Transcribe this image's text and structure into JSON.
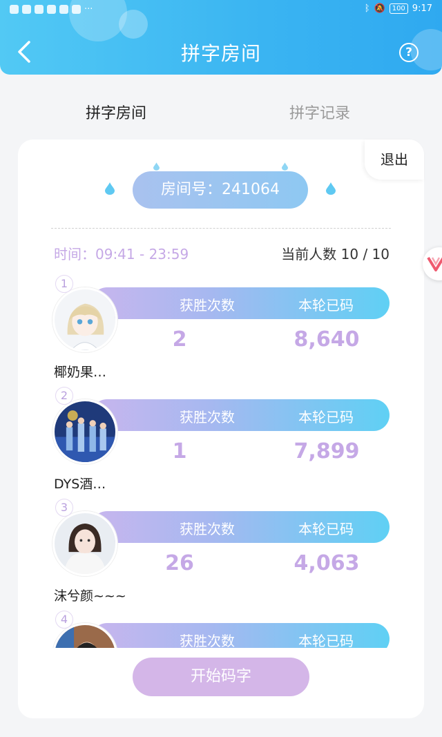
{
  "status_bar": {
    "time": "9:17",
    "battery": "100"
  },
  "header": {
    "title": "拼字房间",
    "help_label": "?"
  },
  "tabs": [
    {
      "label": "拼字房间",
      "active": true
    },
    {
      "label": "拼字记录",
      "active": false
    }
  ],
  "room": {
    "exit_label": "退出",
    "room_number_label": "房间号：241064",
    "time_label": "时间：09:41 - 23:59",
    "count_label": "当前人数 10 / 10",
    "stat_wins_label": "获胜次数",
    "stat_chars_label": "本轮已码",
    "start_button": "开始码字"
  },
  "players": [
    {
      "rank": "1",
      "name": "椰奶果…",
      "wins": "2",
      "chars": "8,640"
    },
    {
      "rank": "2",
      "name": "DYS酒…",
      "wins": "1",
      "chars": "7,899"
    },
    {
      "rank": "3",
      "name": "沫兮颜~~~",
      "wins": "26",
      "chars": "4,063"
    },
    {
      "rank": "4",
      "name": "",
      "wins": "",
      "chars": ""
    }
  ],
  "colors": {
    "header_gradient_start": "#52c9f4",
    "header_gradient_end": "#2fa9f0",
    "accent_purple": "#c5a8e6",
    "start_button": "#d4b6e8"
  }
}
